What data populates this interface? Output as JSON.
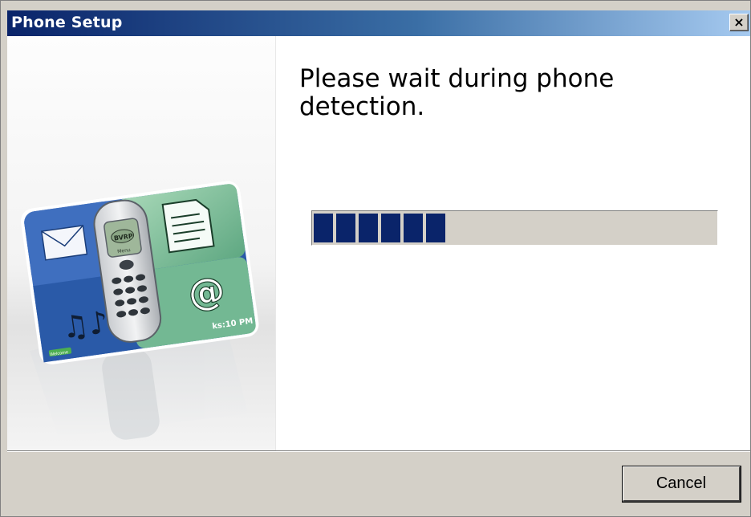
{
  "window": {
    "title": "Phone Setup",
    "close_label": "×"
  },
  "main": {
    "heading": "Please wait during phone detection.",
    "progress_percent": 33
  },
  "illustration": {
    "phone_brand": "BVRP",
    "phone_display": "Menu",
    "card_label": "ks:10 PM",
    "badge": "Welcome"
  },
  "footer": {
    "cancel_label": "Cancel"
  },
  "colors": {
    "title_gradient_start": "#0a246a",
    "title_gradient_end": "#a6caf0",
    "progress_fill": "#0a246a",
    "face": "#d4d0c8"
  }
}
